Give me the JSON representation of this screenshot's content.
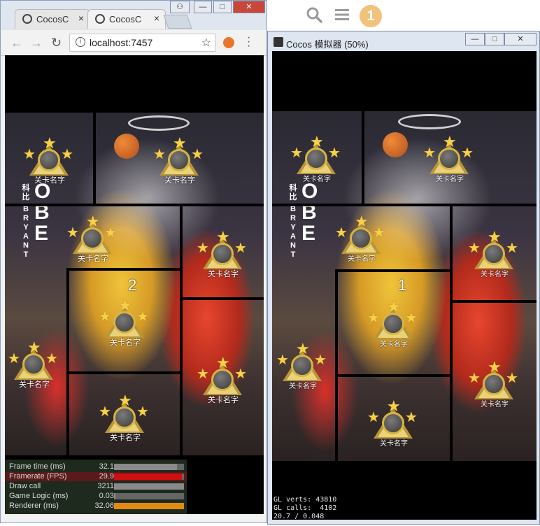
{
  "chrome": {
    "tabs": [
      {
        "label": "CocosC",
        "close": "×"
      },
      {
        "label": "CocosC",
        "close": "×"
      }
    ],
    "window_controls": {
      "minimize": "—",
      "maximize": "□",
      "close": "✕"
    },
    "url": "localhost:7457",
    "info_glyph": "i",
    "star_glyph": "☆",
    "nav": {
      "back": "←",
      "forward": "→",
      "reload": "↻"
    }
  },
  "game_left": {
    "kobe_letters": [
      "O",
      "B",
      "E"
    ],
    "kobe_cn": "科比",
    "bryant": [
      "B",
      "R",
      "Y",
      "A",
      "N",
      "T"
    ],
    "level_label": "关卡名字",
    "big_number": "2"
  },
  "game_right": {
    "level_label": "关卡名字",
    "big_number": "1"
  },
  "stats": [
    {
      "label": "Frame time (ms)",
      "value": "32.1",
      "fill": 0.9,
      "color": "#8a8a8a"
    },
    {
      "label": "Framerate (FPS)",
      "value": "29.9",
      "fill": 0.97,
      "color": "#d01010"
    },
    {
      "label": "Draw call",
      "value": "3211",
      "fill": 1.0,
      "color": "#8a8a8a"
    },
    {
      "label": "Game Logic (ms)",
      "value": "0.03",
      "fill": 0.02,
      "color": "#8a8a8a"
    },
    {
      "label": "Renderer (ms)",
      "value": "32.06",
      "fill": 1.0,
      "color": "#e08a10"
    }
  ],
  "simulator": {
    "title": "Cocos 模拟器 (50%)",
    "gl_stats": [
      "GL verts: 43810",
      "GL calls:  4102",
      "20.7 / 0.048"
    ]
  },
  "top_icons": {
    "search": "search-icon",
    "menu": "hamburger-icon",
    "badge_count": "1"
  }
}
